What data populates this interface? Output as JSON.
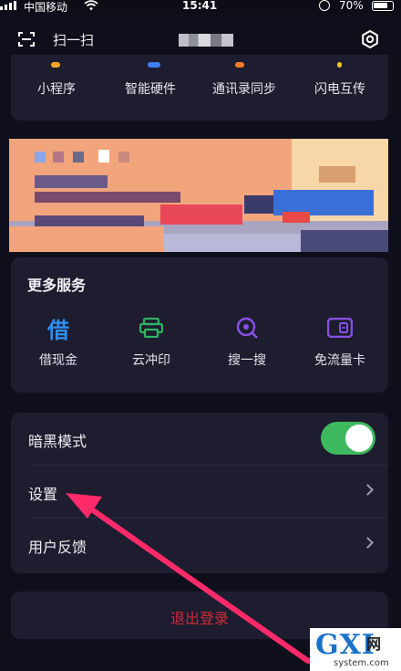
{
  "status_bar": {
    "carrier": "中国移动",
    "time": "15:41",
    "battery": "70%"
  },
  "top_bar": {
    "scan_label": "扫一扫"
  },
  "mini_apps": [
    {
      "label": "小程序",
      "color": "#f5a623"
    },
    {
      "label": "智能硬件",
      "color": "#3d7ef5"
    },
    {
      "label": "通讯录同步",
      "color": "#f57c23"
    },
    {
      "label": "闪电互传",
      "color": "#f5c623"
    }
  ],
  "services": {
    "title": "更多服务",
    "items": [
      {
        "label": "借现金",
        "icon": "borrow-cash-icon",
        "color": "#2f8ff2"
      },
      {
        "label": "云冲印",
        "icon": "printer-icon",
        "color": "#2fb563"
      },
      {
        "label": "搜一搜",
        "icon": "search-icon",
        "color": "#8a4fe8"
      },
      {
        "label": "免流量卡",
        "icon": "sim-card-icon",
        "color": "#8a4fe8"
      }
    ]
  },
  "settings": {
    "dark_mode_label": "暗黑模式",
    "dark_mode_on": true,
    "settings_label": "设置",
    "feedback_label": "用户反馈"
  },
  "logout_label": "退出登录",
  "watermark": {
    "main": "GXI",
    "cn": "网",
    "sub": "system.com"
  },
  "colors": {
    "toggle_on": "#3fb95f",
    "logout": "#d12a3a",
    "arrow": "#ff2a6a",
    "card": "#1d1d2f"
  }
}
